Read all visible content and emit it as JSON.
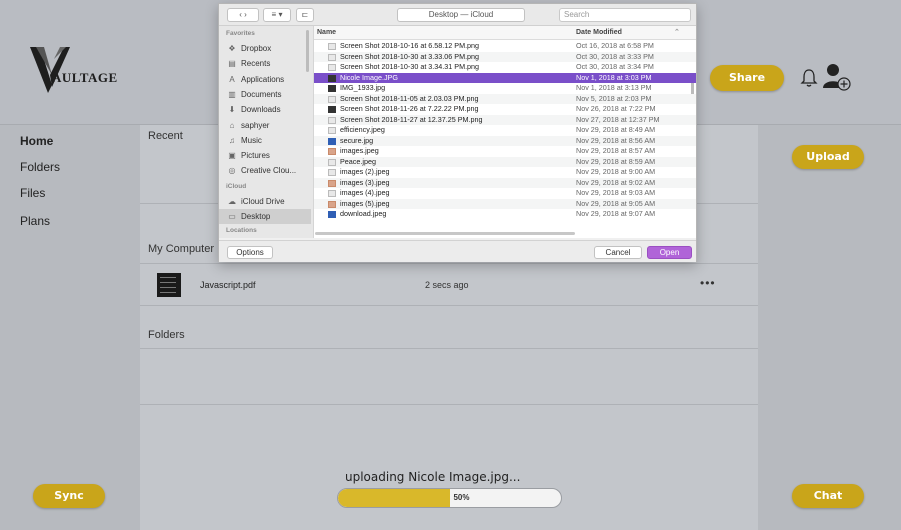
{
  "app": {
    "brand": "AULTAGE",
    "share_label": "Share",
    "upload_label": "Upload",
    "sync_label": "Sync",
    "chat_label": "Chat",
    "accent_color": "#c9a51a",
    "nav": [
      "Home",
      "Folders",
      "Files",
      "Plans"
    ],
    "sections": {
      "recent": "Recent",
      "my_computer": "My Computer",
      "folders": "Folders"
    },
    "recent_file": {
      "name": "Javascript.pdf",
      "time": "2 secs ago",
      "more": "•••"
    },
    "upload_status": "uploading Nicole Image.jpg...",
    "progress": {
      "label": "50%",
      "fraction": 0.5
    }
  },
  "dialog": {
    "toolbar": {
      "back": "‹  ›",
      "view": "≡ ▾",
      "new_folder": "⊏",
      "location": "Desktop — iCloud",
      "search_placeholder": "Search"
    },
    "sidebar": {
      "favorites_heading": "Favorites",
      "favorites": [
        {
          "label": "Dropbox",
          "icon": "dropbox-icon",
          "glyph": "❖"
        },
        {
          "label": "Recents",
          "icon": "recents-icon",
          "glyph": "▤"
        },
        {
          "label": "Applications",
          "icon": "applications-icon",
          "glyph": "A"
        },
        {
          "label": "Documents",
          "icon": "documents-icon",
          "glyph": "▥"
        },
        {
          "label": "Downloads",
          "icon": "downloads-icon",
          "glyph": "⬇"
        },
        {
          "label": "saphyer",
          "icon": "home-icon",
          "glyph": "⌂"
        },
        {
          "label": "Music",
          "icon": "music-icon",
          "glyph": "♫"
        },
        {
          "label": "Pictures",
          "icon": "pictures-icon",
          "glyph": "▣"
        },
        {
          "label": "Creative Clou...",
          "icon": "creative-cloud-icon",
          "glyph": "◎"
        }
      ],
      "icloud_heading": "iCloud",
      "icloud": [
        {
          "label": "iCloud Drive",
          "icon": "cloud-icon",
          "glyph": "☁"
        },
        {
          "label": "Desktop",
          "icon": "desktop-icon",
          "glyph": "▭"
        }
      ],
      "locations_heading": "Locations"
    },
    "columns": {
      "name": "Name",
      "date": "Date Modified"
    },
    "files": [
      {
        "name": "Screen Shot 2018-10-16 at 6.58.12 PM.png",
        "date": "Oct 16, 2018 at 6:58 PM",
        "icon": "plain"
      },
      {
        "name": "Screen Shot 2018-10-30 at 3.33.06 PM.png",
        "date": "Oct 30, 2018 at 3:33 PM",
        "icon": "plain"
      },
      {
        "name": "Screen Shot 2018-10-30 at 3.34.31 PM.png",
        "date": "Oct 30, 2018 at 3:34 PM",
        "icon": "plain"
      },
      {
        "name": "Nicole Image.JPG",
        "date": "Nov 1, 2018 at 3:03 PM",
        "icon": "dark",
        "selected": true
      },
      {
        "name": "IMG_1933.jpg",
        "date": "Nov 1, 2018 at 3:13 PM",
        "icon": "dark"
      },
      {
        "name": "Screen Shot 2018-11-05 at 2.03.03 PM.png",
        "date": "Nov 5, 2018 at 2:03 PM",
        "icon": "plain"
      },
      {
        "name": "Screen Shot 2018-11-26 at 7.22.22 PM.png",
        "date": "Nov 26, 2018 at 7:22 PM",
        "icon": "dark"
      },
      {
        "name": "Screen Shot 2018-11-27 at 12.37.25 PM.png",
        "date": "Nov 27, 2018 at 12:37 PM",
        "icon": "plain"
      },
      {
        "name": "efficiency.jpeg",
        "date": "Nov 29, 2018 at 8:49 AM",
        "icon": "plain"
      },
      {
        "name": "secure.jpg",
        "date": "Nov 29, 2018 at 8:56 AM",
        "icon": "blue"
      },
      {
        "name": "images.jpeg",
        "date": "Nov 29, 2018 at 8:57 AM",
        "icon": "warm"
      },
      {
        "name": "Peace.jpeg",
        "date": "Nov 29, 2018 at 8:59 AM",
        "icon": "plain"
      },
      {
        "name": "images (2).jpeg",
        "date": "Nov 29, 2018 at 9:00 AM",
        "icon": "plain"
      },
      {
        "name": "images (3).jpeg",
        "date": "Nov 29, 2018 at 9:02 AM",
        "icon": "warm"
      },
      {
        "name": "images (4).jpeg",
        "date": "Nov 29, 2018 at 9:03 AM",
        "icon": "plain"
      },
      {
        "name": "images (5).jpeg",
        "date": "Nov 29, 2018 at 9:05 AM",
        "icon": "warm"
      },
      {
        "name": "download.jpeg",
        "date": "Nov 29, 2018 at 9:07 AM",
        "icon": "blue"
      }
    ],
    "options_label": "Options",
    "cancel_label": "Cancel",
    "open_label": "Open",
    "open_color": "#b064d8",
    "selection_color": "#7a4fc9"
  }
}
